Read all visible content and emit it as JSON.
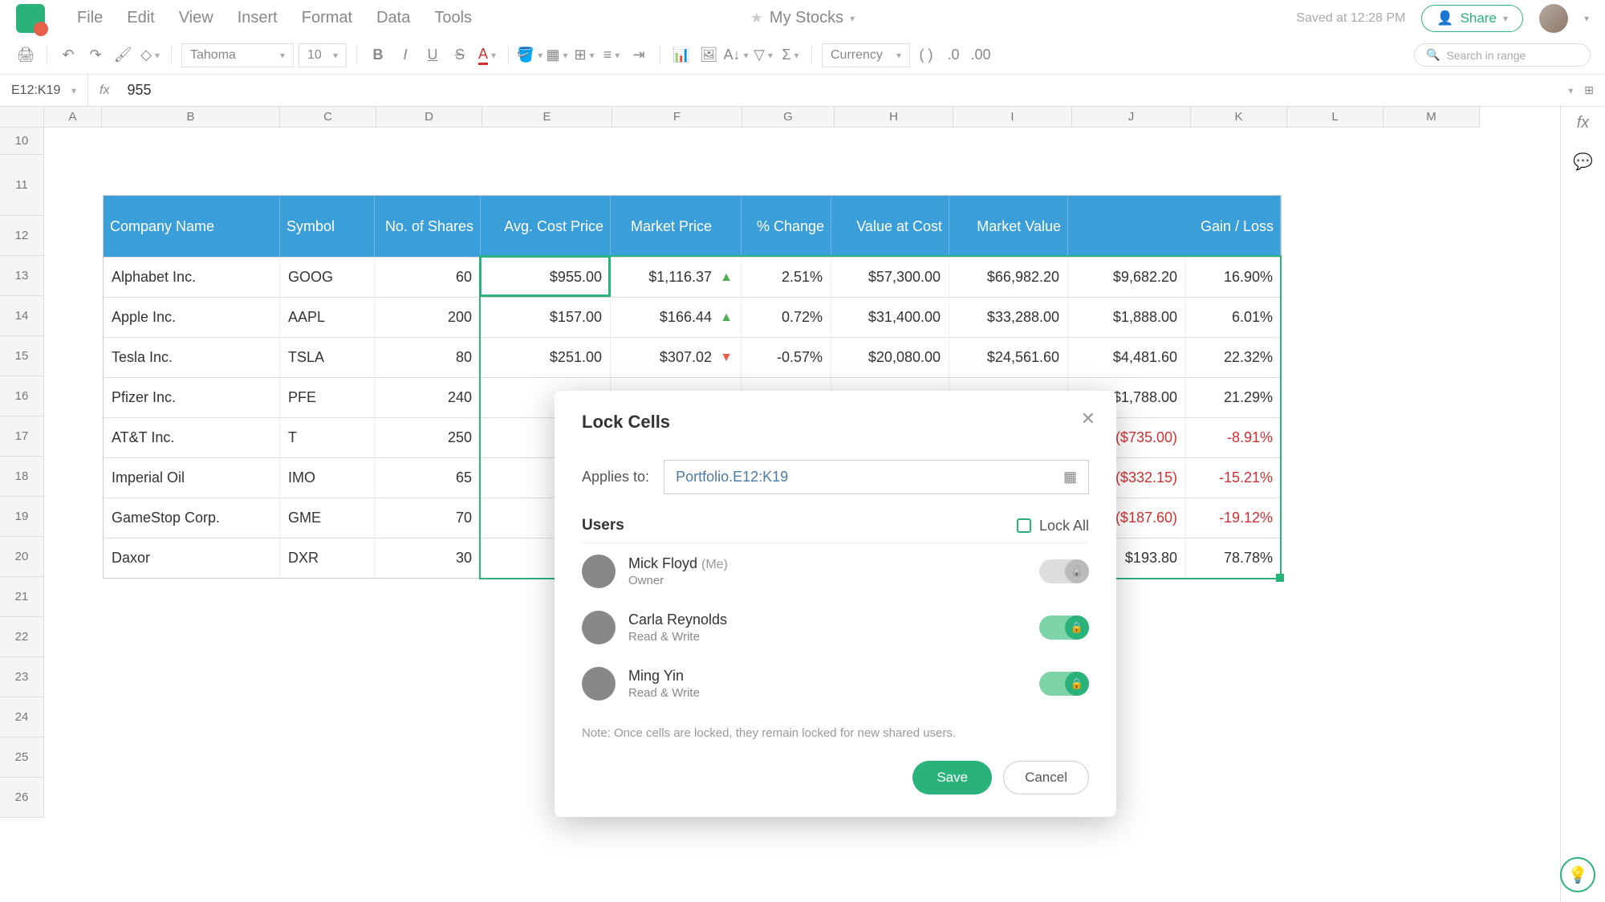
{
  "header": {
    "doc_title": "My Stocks",
    "saved_text": "Saved at 12:28 PM",
    "share_label": "Share",
    "menu": [
      "File",
      "Edit",
      "View",
      "Insert",
      "Format",
      "Data",
      "Tools"
    ]
  },
  "toolbar": {
    "font": "Tahoma",
    "size": "10",
    "format": "Currency",
    "search_placeholder": "Search in range"
  },
  "formula": {
    "cell_ref": "E12:K19",
    "value": "955"
  },
  "columns": [
    "A",
    "B",
    "C",
    "D",
    "E",
    "F",
    "G",
    "H",
    "I",
    "J",
    "K",
    "L",
    "M"
  ],
  "rows": [
    "10",
    "11",
    "12",
    "13",
    "14",
    "15",
    "16",
    "17",
    "18",
    "19",
    "20",
    "21",
    "22",
    "23",
    "24",
    "25",
    "26"
  ],
  "table": {
    "headers": [
      "Company Name",
      "Symbol",
      "No. of Shares",
      "Avg. Cost Price",
      "Market Price",
      "% Change",
      "Value at Cost",
      "Market Value",
      "Gain / Loss",
      ""
    ],
    "rows": [
      {
        "company": "Alphabet Inc.",
        "symbol": "GOOG",
        "shares": "60",
        "cost": "$955.00",
        "market": "$1,116.37",
        "dir": "up",
        "change": "2.51%",
        "valcost": "$57,300.00",
        "mktval": "$66,982.20",
        "gain": "$9,682.20",
        "pct": "16.90%"
      },
      {
        "company": "Apple Inc.",
        "symbol": "AAPL",
        "shares": "200",
        "cost": "$157.00",
        "market": "$166.44",
        "dir": "up",
        "change": "0.72%",
        "valcost": "$31,400.00",
        "mktval": "$33,288.00",
        "gain": "$1,888.00",
        "pct": "6.01%"
      },
      {
        "company": "Tesla Inc.",
        "symbol": "TSLA",
        "shares": "80",
        "cost": "$251.00",
        "market": "$307.02",
        "dir": "down",
        "change": "-0.57%",
        "valcost": "$20,080.00",
        "mktval": "$24,561.60",
        "gain": "$4,481.60",
        "pct": "22.32%"
      },
      {
        "company": "Pfizer Inc.",
        "symbol": "PFE",
        "shares": "240",
        "cost": "",
        "market": "",
        "dir": "",
        "change": "",
        "valcost": "",
        "mktval": "",
        "gain": "$1,788.00",
        "pct": "21.29%"
      },
      {
        "company": "AT&T Inc.",
        "symbol": "T",
        "shares": "250",
        "cost": "",
        "market": "",
        "dir": "",
        "change": "",
        "valcost": "",
        "mktval": "",
        "gain": "($735.00)",
        "pct": "-8.91%",
        "neg": true
      },
      {
        "company": "Imperial Oil",
        "symbol": "IMO",
        "shares": "65",
        "cost": "",
        "market": "",
        "dir": "",
        "change": "",
        "valcost": "",
        "mktval": "",
        "gain": "($332.15)",
        "pct": "-15.21%",
        "neg": true
      },
      {
        "company": "GameStop Corp.",
        "symbol": "GME",
        "shares": "70",
        "cost": "",
        "market": "",
        "dir": "",
        "change": "",
        "valcost": "",
        "mktval": "",
        "gain": "($187.60)",
        "pct": "-19.12%",
        "neg": true
      },
      {
        "company": "Daxor",
        "symbol": "DXR",
        "shares": "30",
        "cost": "",
        "market": "",
        "dir": "",
        "change": "",
        "valcost": "",
        "mktval": "",
        "gain": "$193.80",
        "pct": "78.78%"
      }
    ]
  },
  "dialog": {
    "title": "Lock Cells",
    "applies_label": "Applies to:",
    "applies_value": "Portfolio.E12:K19",
    "users_label": "Users",
    "lockall_label": "Lock All",
    "note": "Note:  Once cells are locked, they remain locked for new shared users.",
    "save": "Save",
    "cancel": "Cancel",
    "users": [
      {
        "name": "Mick Floyd",
        "me": "(Me)",
        "role": "Owner",
        "locked": false
      },
      {
        "name": "Carla Reynolds",
        "me": "",
        "role": "Read & Write",
        "locked": true
      },
      {
        "name": "Ming Yin",
        "me": "",
        "role": "Read & Write",
        "locked": true
      }
    ]
  }
}
